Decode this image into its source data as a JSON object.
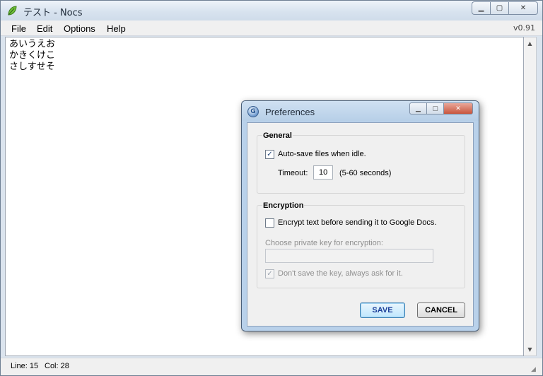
{
  "window": {
    "title": "テスト - Nocs",
    "version": "v0.91"
  },
  "menu": [
    "File",
    "Edit",
    "Options",
    "Help"
  ],
  "editor": {
    "lines": [
      "あいうえお",
      "かきくけこ",
      "さしすせそ"
    ]
  },
  "status": {
    "line": "Line: 15",
    "col": "Col: 28"
  },
  "dialog": {
    "title": "Preferences",
    "general": {
      "heading": "General",
      "autosave_label": "Auto-save files when idle.",
      "autosave_checked": true,
      "timeout_label": "Timeout:",
      "timeout_value": "10",
      "timeout_hint": "(5-60 seconds)"
    },
    "encryption": {
      "heading": "Encryption",
      "encrypt_label": "Encrypt text before sending it to Google Docs.",
      "encrypt_checked": false,
      "key_label": "Choose private key for encryption:",
      "key_value": "",
      "dontsave_label": "Don't save the key, always ask for it.",
      "dontsave_checked": true
    },
    "buttons": {
      "save": "SAVE",
      "cancel": "CANCEL"
    }
  },
  "colors": {
    "accent": "#1c3f9a",
    "frame": "#b9d1ea"
  },
  "icons": {
    "app": "green-leaf-icon",
    "dialog": "google-g-icon"
  }
}
